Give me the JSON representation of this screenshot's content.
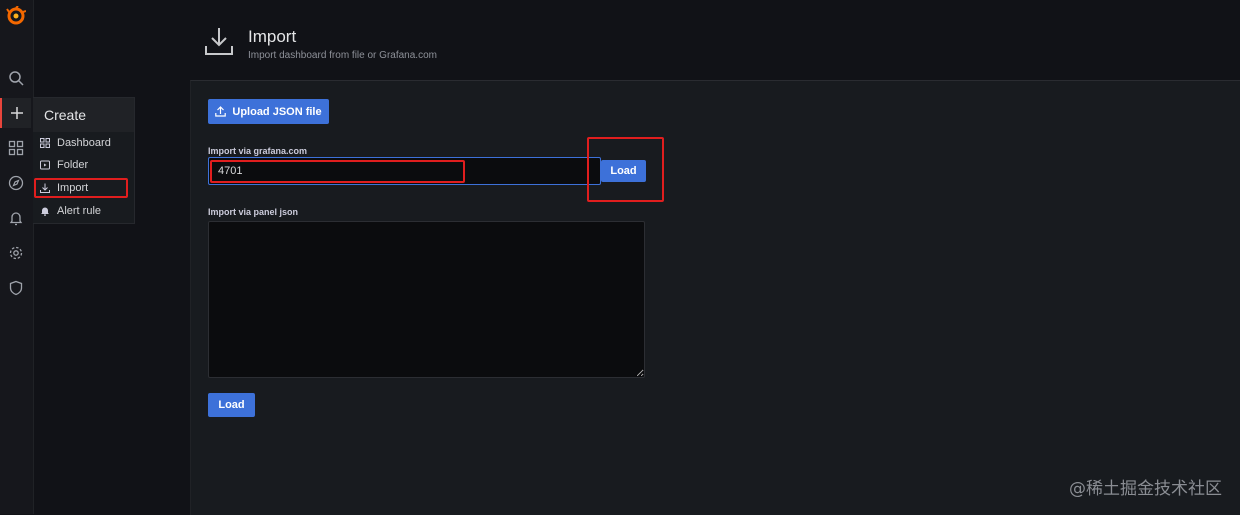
{
  "sidebar": {
    "icons": [
      "grafana-logo",
      "search-icon",
      "plus-icon",
      "dashboards-icon",
      "explore-icon",
      "bell-icon",
      "gear-icon",
      "shield-icon"
    ]
  },
  "create_menu": {
    "header": "Create",
    "items": [
      {
        "label": "Dashboard",
        "icon": "apps-icon"
      },
      {
        "label": "Folder",
        "icon": "folder-icon"
      },
      {
        "label": "Import",
        "icon": "import-icon"
      },
      {
        "label": "Alert rule",
        "icon": "bell-icon"
      }
    ]
  },
  "page": {
    "title": "Import",
    "subtitle": "Import dashboard from file or Grafana.com"
  },
  "import_form": {
    "upload_label": "Upload JSON file",
    "grafana_label": "Import via grafana.com",
    "grafana_value": "4701",
    "load_label": "Load",
    "panel_json_label": "Import via panel json",
    "panel_json_value": "",
    "load_bottom_label": "Load"
  },
  "watermark": "@稀土掘金技术社区",
  "colors": {
    "accent": "#3d71d9",
    "highlight": "#e01e1e",
    "background": "#111217",
    "panel": "#181b1f"
  }
}
